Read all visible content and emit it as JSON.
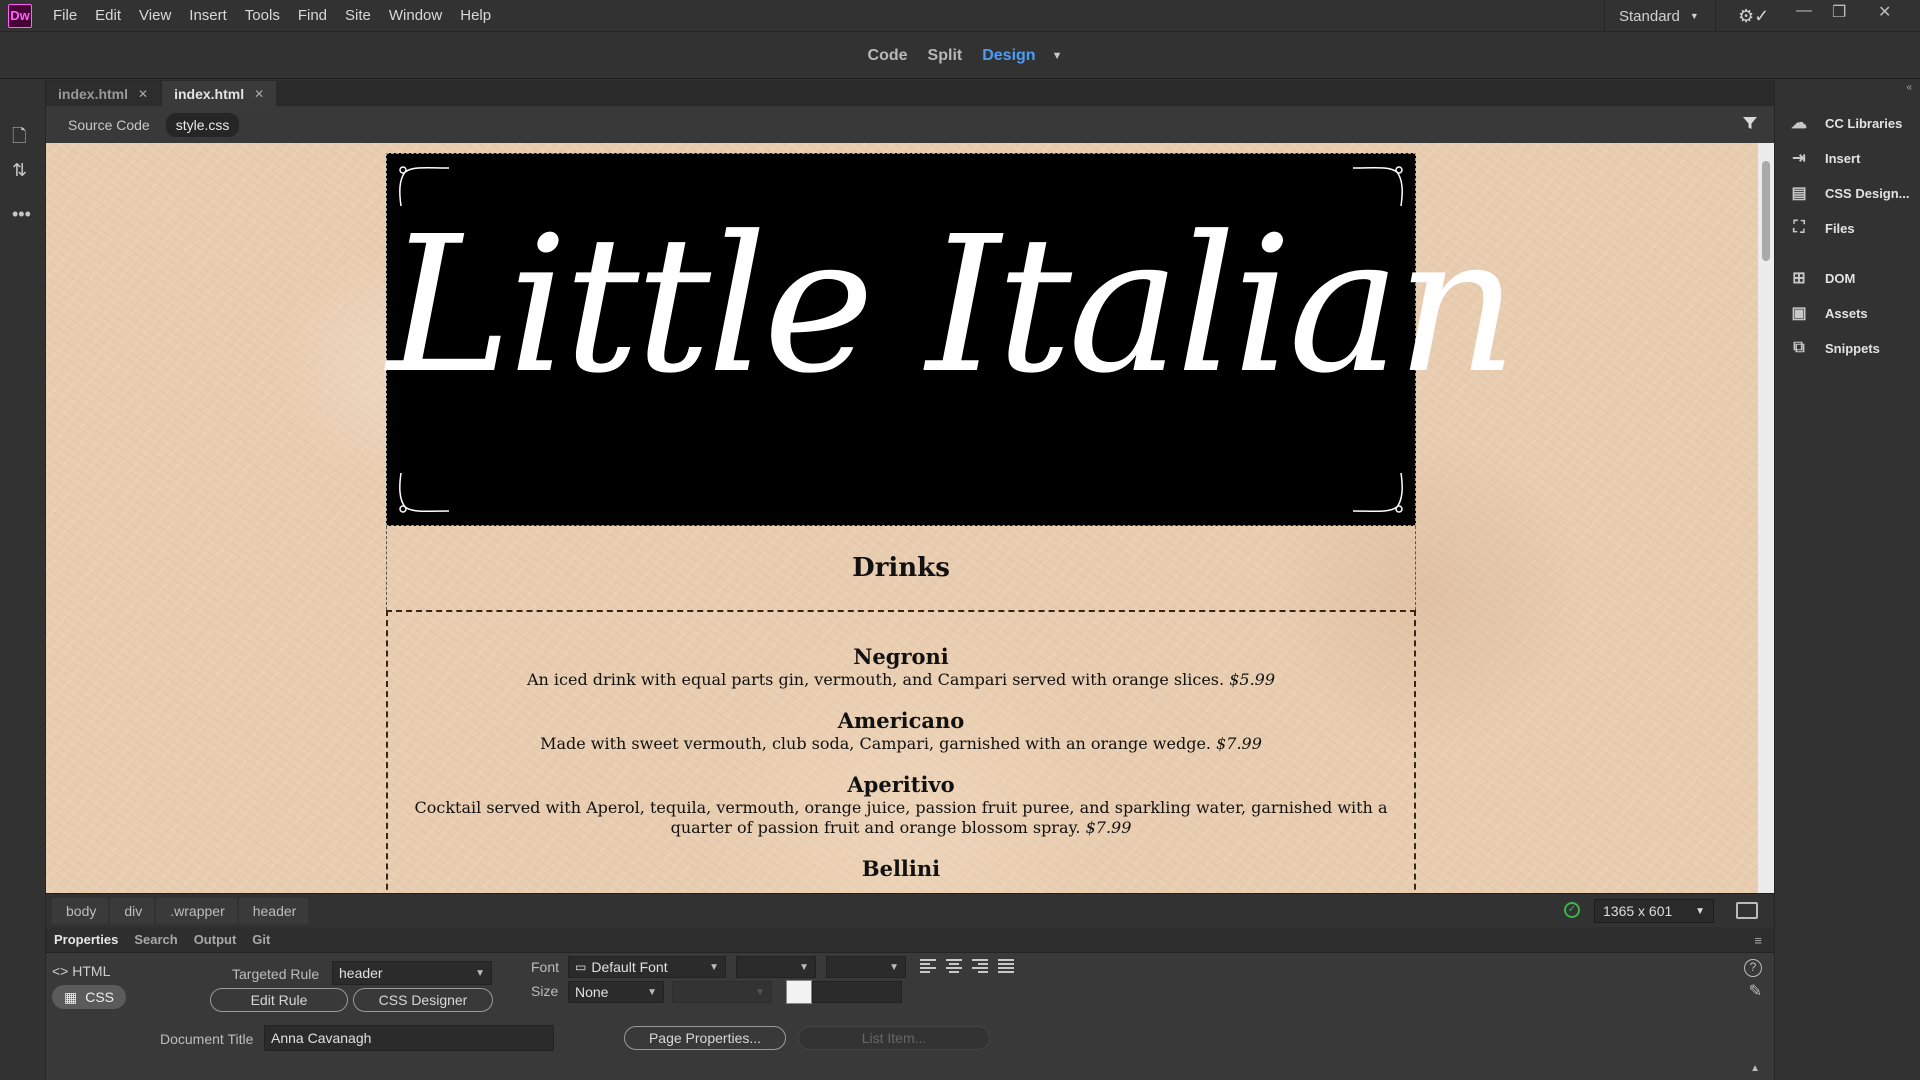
{
  "app": {
    "logo": "Dw",
    "workspace": "Standard"
  },
  "menu": [
    "File",
    "Edit",
    "View",
    "Insert",
    "Tools",
    "Find",
    "Site",
    "Window",
    "Help"
  ],
  "views": {
    "code": "Code",
    "split": "Split",
    "design": "Design",
    "active": "Design"
  },
  "tabs": [
    {
      "label": "index.html",
      "active": false
    },
    {
      "label": "index.html",
      "active": true
    }
  ],
  "related_files": [
    {
      "label": "Source Code",
      "active": false
    },
    {
      "label": "style.css",
      "active": true
    }
  ],
  "page": {
    "logo_text": "Little Italian",
    "section_title": "Drinks",
    "drinks": [
      {
        "name": "Negroni",
        "desc": "An iced drink with equal parts gin, vermouth, and Campari served with orange slices.",
        "price": "$5.99"
      },
      {
        "name": "Americano",
        "desc": "Made with sweet vermouth, club soda, Campari, garnished with an orange wedge.",
        "price": "$7.99"
      },
      {
        "name": "Aperitivo",
        "desc": "Cocktail served with Aperol, tequila, vermouth, orange juice, passion fruit puree, and sparkling water, garnished with a quarter of passion fruit and orange blossom spray.",
        "price": "$7.99"
      },
      {
        "name": "Bellini",
        "desc": "",
        "price": ""
      }
    ]
  },
  "status": {
    "breadcrumbs": [
      "body",
      "div",
      ".wrapper",
      "header"
    ],
    "dimensions": "1365 x 601"
  },
  "properties": {
    "tabs": [
      "Properties",
      "Search",
      "Output",
      "Git"
    ],
    "html_label": "HTML",
    "css_label": "CSS",
    "targeted_rule_label": "Targeted Rule",
    "targeted_rule_value": "header",
    "edit_rule": "Edit Rule",
    "css_designer": "CSS Designer",
    "font_label": "Font",
    "font_value": "Default Font",
    "size_label": "Size",
    "size_value": "None",
    "document_title_label": "Document Title",
    "document_title_value": "Anna Cavanagh",
    "page_properties": "Page Properties...",
    "list_item": "List Item..."
  },
  "right_panel": [
    "CC Libraries",
    "Insert",
    "CSS Design...",
    "Files",
    "DOM",
    "Assets",
    "Snippets"
  ],
  "colors": {
    "accent": "#4b9cf5",
    "logo_bg": "#470137",
    "logo_fg": "#ff61f6",
    "valid": "#3bb54a"
  }
}
